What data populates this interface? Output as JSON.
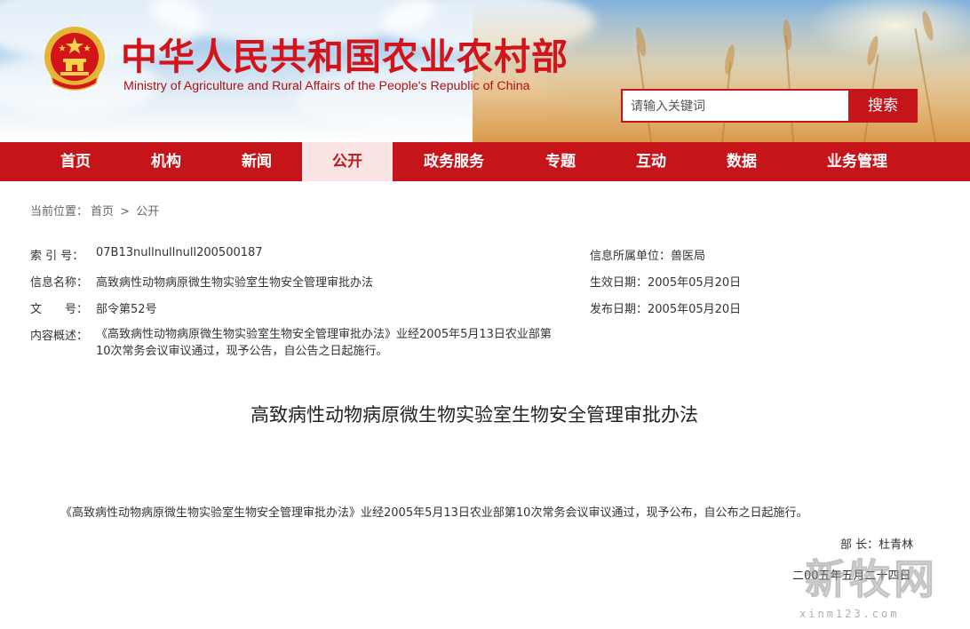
{
  "header": {
    "title_cn": "中华人民共和国农业农村部",
    "title_en": "Ministry of Agriculture and Rural Affairs of the People's Republic of China",
    "search_placeholder": "请输入关键词",
    "search_button": "搜索",
    "brand_color": "#c5151b"
  },
  "nav": {
    "items": [
      {
        "label": "首页",
        "active": false
      },
      {
        "label": "机构",
        "active": false
      },
      {
        "label": "新闻",
        "active": false
      },
      {
        "label": "公开",
        "active": true
      },
      {
        "label": "政务服务",
        "active": false
      },
      {
        "label": "专题",
        "active": false
      },
      {
        "label": "互动",
        "active": false
      },
      {
        "label": "数据",
        "active": false
      },
      {
        "label": "业务管理",
        "active": false
      }
    ]
  },
  "breadcrumb": {
    "prefix": "当前位置：",
    "home": "首页",
    "separator": ">",
    "current": "公开"
  },
  "meta": {
    "index_label": "索 引 号：",
    "index_value": "07B13nullnullnull200500187",
    "name_label": "信息名称：",
    "name_value": "高致病性动物病原微生物实验室生物安全管理审批办法",
    "doc_label": "文　　号：",
    "doc_value": "部令第52号",
    "summary_label": "内容概述：",
    "summary_value": "《高致病性动物病原微生物实验室生物安全管理审批办法》业经2005年5月13日农业部第10次常务会议审议通过，现予公告，自公告之日起施行。",
    "unit": "信息所属单位：兽医局",
    "effective": "生效日期：2005年05月20日",
    "published": "发布日期：2005年05月20日"
  },
  "document": {
    "title": "高致病性动物病原微生物实验室生物安全管理审批办法",
    "body": "《高致病性动物病原微生物实验室生物安全管理审批办法》业经2005年5月13日农业部第10次常务会议审议通过，现予公布，自公布之日起施行。",
    "signature": "部 长：杜青林",
    "date": "二00五年五月二十四日"
  },
  "watermark": {
    "text": "新牧网",
    "url": "xinm123.com"
  }
}
